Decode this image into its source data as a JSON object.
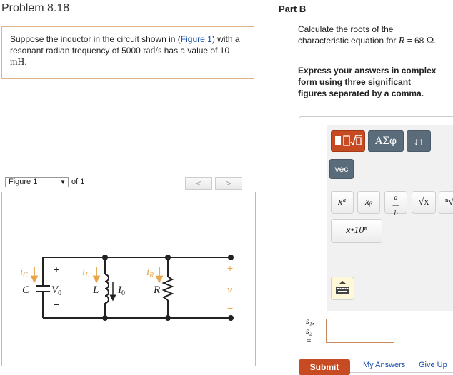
{
  "problem": {
    "title": "Problem 8.18",
    "text_before_link": "Suppose the inductor in the circuit shown in (",
    "figure_link": "Figure 1",
    "text_after_link": ") with a resonant radian frequency of 5000 ",
    "freq_unit": "rad/s",
    "text_mid": " has a value of 10 ",
    "ind_unit": "mH",
    "text_end": "."
  },
  "figure_nav": {
    "selected": "Figure 1",
    "of_text": "of 1",
    "prev_label": "<",
    "next_label": ">"
  },
  "circuit": {
    "labels": {
      "ic": "i",
      "ic_sub": "C",
      "il": "i",
      "il_sub": "L",
      "ir": "i",
      "ir_sub": "R",
      "plus_left": "+",
      "minus_left": "−",
      "C": "C",
      "V0": "V",
      "V0_sub": "0",
      "L": "L",
      "I0": "I",
      "I0_sub": "0",
      "R": "R",
      "plus_right": "+",
      "v": "v",
      "minus_right": "−"
    },
    "colors": {
      "current_arrow": "#e8a64a",
      "wire": "#222222"
    }
  },
  "part": {
    "label": "Part B",
    "question_text": "Calculate the roots of the characteristic equation for ",
    "R_symbol": "R",
    "equals": " = ",
    "value": "68 ",
    "unit": "Ω",
    "end": ".",
    "instructions": "Express your answers in complex form using three significant figures separated by a comma."
  },
  "toolbar": {
    "greek_label": "ΑΣφ",
    "arrows_label": "↓↑",
    "vec_label": "vec",
    "power_label": "xᵃ",
    "subscript_label": "xᵦ",
    "sqrt_label": "√x",
    "nthroot_label": "ⁿ√",
    "sci_label": "x•10ⁿ"
  },
  "answer": {
    "label_s1": "s₁,",
    "label_s2": "s₂",
    "label_eq": "=",
    "value": ""
  },
  "actions": {
    "submit": "Submit",
    "my_answers": "My Answers",
    "give_up": "Give Up"
  },
  "colors": {
    "accent": "#c74b22",
    "border_orange": "#e0b48a",
    "link": "#1a4fb0"
  }
}
